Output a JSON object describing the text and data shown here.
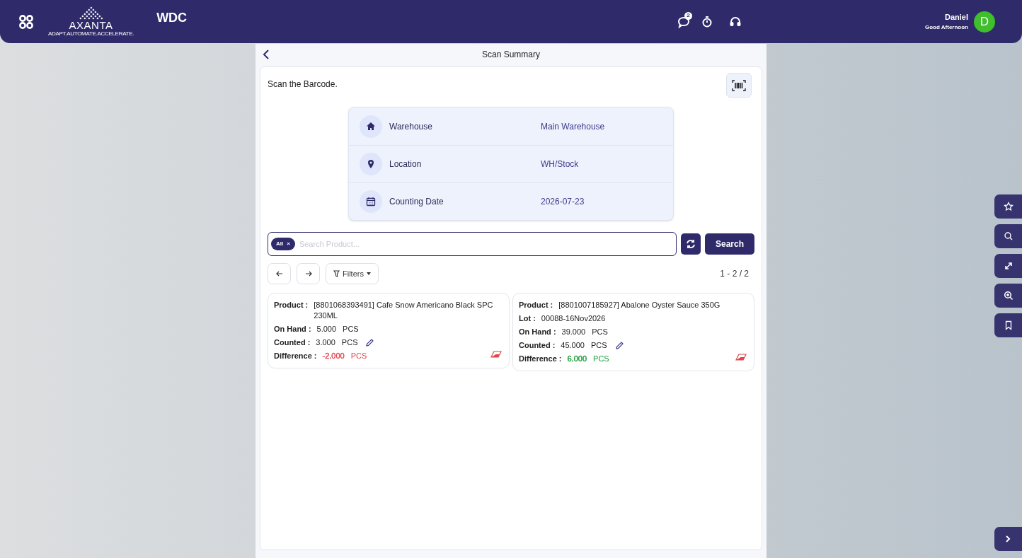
{
  "header": {
    "app_name": "WDC",
    "logo": {
      "name": "AXANTA",
      "tagline": "ADAPT.AUTOMATE.ACCELERATE."
    },
    "notifications_count": "2",
    "user": {
      "name": "Daniel",
      "greeting": "Good Afternoon",
      "initial": "D"
    }
  },
  "page": {
    "title": "Scan Summary",
    "scan_prompt": "Scan the Barcode."
  },
  "info": [
    {
      "kind": "home",
      "label": "Warehouse",
      "value": "Main Warehouse"
    },
    {
      "kind": "pin",
      "label": "Location",
      "value": "WH/Stock"
    },
    {
      "kind": "calendar",
      "label": "Counting Date",
      "value": "2026-07-23"
    }
  ],
  "search": {
    "chip": "All",
    "chip_remove": "×",
    "placeholder": "Search Product...",
    "button": "Search"
  },
  "pager": {
    "filters": "Filters",
    "range": "1 - 2 / 2"
  },
  "cards": [
    {
      "rows": [
        {
          "kind": "text",
          "label": "Product :",
          "value": "[8801068393491] Cafe Snow Americano Black SPC 230ML"
        },
        {
          "kind": "qty",
          "label": "On Hand :",
          "value": "5.000",
          "unit": "PCS"
        },
        {
          "kind": "counted",
          "label": "Counted :",
          "value": "3.000",
          "unit": "PCS"
        },
        {
          "kind": "difference",
          "label": "Difference :",
          "value": "-2.000",
          "unit": "PCS",
          "color": "#e0474c"
        }
      ]
    },
    {
      "rows": [
        {
          "kind": "text",
          "label": "Product :",
          "value": "[8801007185927] Abalone Oyster Sauce 350G"
        },
        {
          "kind": "text",
          "label": "Lot :",
          "value": "00088-16Nov2026"
        },
        {
          "kind": "qty",
          "label": "On Hand :",
          "value": "39.000",
          "unit": "PCS"
        },
        {
          "kind": "counted",
          "label": "Counted :",
          "value": "45.000",
          "unit": "PCS"
        },
        {
          "kind": "difference",
          "label": "Difference :",
          "value": "6.000",
          "unit": "PCS",
          "color": "#1a9c3a"
        }
      ]
    }
  ]
}
